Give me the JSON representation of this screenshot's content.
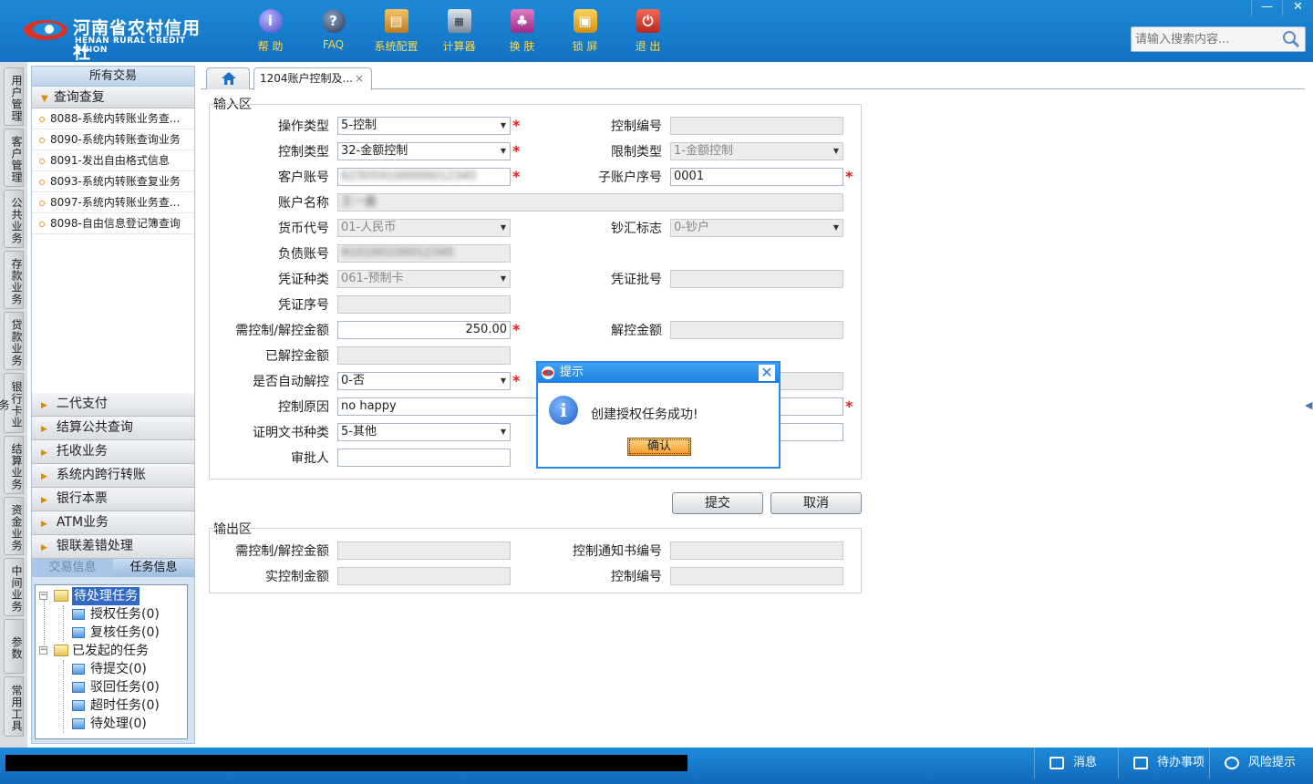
{
  "header": {
    "brand_cn": "河南省农村信用社",
    "brand_en": "HENAN RURAL CREDIT UNION",
    "toolbar": [
      {
        "label": "帮 助",
        "icon": "help-icon",
        "glyph": "i"
      },
      {
        "label": "FAQ",
        "icon": "faq-icon",
        "glyph": "?"
      },
      {
        "label": "系统配置",
        "icon": "settings-box-icon",
        "glyph": "▤"
      },
      {
        "label": "计算器",
        "icon": "calculator-icon",
        "glyph": "▦"
      },
      {
        "label": "换 肤",
        "icon": "skin-shirt-icon",
        "glyph": "♣"
      },
      {
        "label": "锁 屏",
        "icon": "lock-icon",
        "glyph": "▣"
      },
      {
        "label": "退 出",
        "icon": "power-icon",
        "glyph": "⏻"
      }
    ],
    "window_minimize": "—",
    "window_close": "✕",
    "search_placeholder": "请输入搜索内容..."
  },
  "side_tabs": [
    "用户管理",
    "客户管理",
    "公共业务",
    "存款业务",
    "贷款业务",
    "银行卡业务",
    "结算业务",
    "资金业务",
    "中间业务",
    "参数",
    "常用工具"
  ],
  "left_panel": {
    "header": "所有交易",
    "open_section": "查询查复",
    "sub_items": [
      "8088-系统内转账业务查...",
      "8090-系统内转账查询业务",
      "8091-发出自由格式信息",
      "8093-系统内转账查复业务",
      "8097-系统内转账业务查...",
      "8098-自由信息登记簿查询"
    ],
    "sections": [
      "二代支付",
      "结算公共查询",
      "托收业务",
      "系统内跨行转账",
      "银行本票",
      "ATM业务",
      "银联差错处理"
    ],
    "tabs": {
      "transaction": "交易信息",
      "task": "任务信息"
    },
    "tree": {
      "pending": "待处理任务",
      "authorize": "授权任务(0)",
      "review": "复核任务(0)",
      "initiated": "已发起的任务",
      "to_submit": "待提交(0)",
      "rejected": "驳回任务(0)",
      "timeout": "超时任务(0)",
      "to_process": "待处理(0)"
    }
  },
  "tabs": {
    "active": "1204账户控制及...",
    "close": "×"
  },
  "input_area": {
    "title": "输入区",
    "op_type_label": "操作类型",
    "op_type": "5-控制",
    "ctrl_no_label": "控制编号",
    "ctrl_no": "",
    "ctrl_type_label": "控制类型",
    "ctrl_type": "32-金额控制",
    "limit_type_label": "限制类型",
    "limit_type": "1-金额控制",
    "cust_acct_label": "客户账号",
    "cust_acct": "623059100000012345",
    "sub_seq_label": "子账户序号",
    "sub_seq": "0001",
    "acct_name_label": "账户名称",
    "acct_name": "王一鑫",
    "currency_label": "货币代号",
    "currency": "01-人民币",
    "cash_flag_label": "钞汇标志",
    "cash_flag": "0-钞户",
    "debt_acct_label": "负债账号",
    "debt_acct": "410100100012345",
    "voucher_type_label": "凭证种类",
    "voucher_type": "061-预制卡",
    "voucher_batch_label": "凭证批号",
    "voucher_batch": "",
    "voucher_seq_label": "凭证序号",
    "voucher_seq": "",
    "amount_label": "需控制/解控金额",
    "amount": "250.00",
    "unlock_amount_label": "解控金额",
    "unlock_amount": "",
    "released_label": "已解控金额",
    "released": "",
    "auto_release_label": "是否自动解控",
    "auto_release": "0-否",
    "reason_label": "控制原因",
    "reason": "no happy",
    "doc_type_label": "证明文书种类",
    "doc_type": "5-其他",
    "approver_label": "审批人",
    "approver": ""
  },
  "buttons": {
    "submit": "提交",
    "cancel": "取消"
  },
  "output_area": {
    "title": "输出区",
    "amount_label": "需控制/解控金额",
    "amount": "",
    "notice_no_label": "控制通知书编号",
    "notice_no": "",
    "actual_label": "实控制金额",
    "actual": "",
    "ctrl_no_label": "控制编号",
    "ctrl_no": ""
  },
  "dialog": {
    "title": "提示",
    "message": "创建授权任务成功!",
    "ok": "确认",
    "close": "✕",
    "info_glyph": "i"
  },
  "statusbar": {
    "message": "消息",
    "todo": "待办事项",
    "risk": "风险提示"
  },
  "colors": {
    "header_blue": "#1d8ad8",
    "required_star": "#e0201a",
    "dialog_border": "#2a8ae6"
  }
}
